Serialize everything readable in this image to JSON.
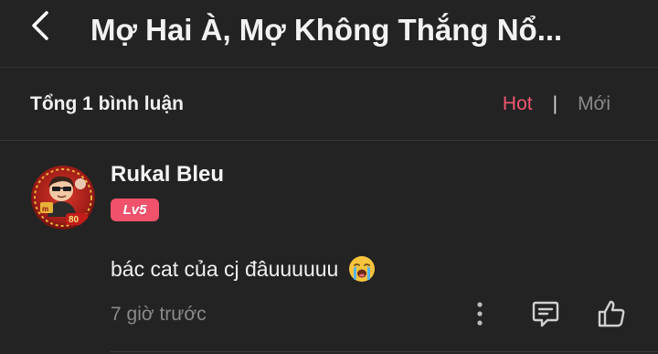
{
  "header": {
    "back_icon": "chevron-left-icon",
    "title": "Mợ Hai À, Mợ Không Thắng Nổ..."
  },
  "comments_bar": {
    "count_label": "Tổng 1 bình luận",
    "sort_hot": "Hot",
    "separator": "|",
    "sort_new": "Mới",
    "active_sort": "Hot",
    "accent_color": "#f05670"
  },
  "comment": {
    "username": "Rukal Bleu",
    "level": "Lv5",
    "text": "bác cat của cj đâuuuuuu",
    "emoji": "loudly-crying-face",
    "timestamp": "7 giờ trước",
    "actions": [
      "more-vertical-icon",
      "reply-icon",
      "like-icon"
    ]
  },
  "theme": {
    "background": "#232323",
    "divider": "#353535",
    "badge_color": "#f0516b"
  }
}
